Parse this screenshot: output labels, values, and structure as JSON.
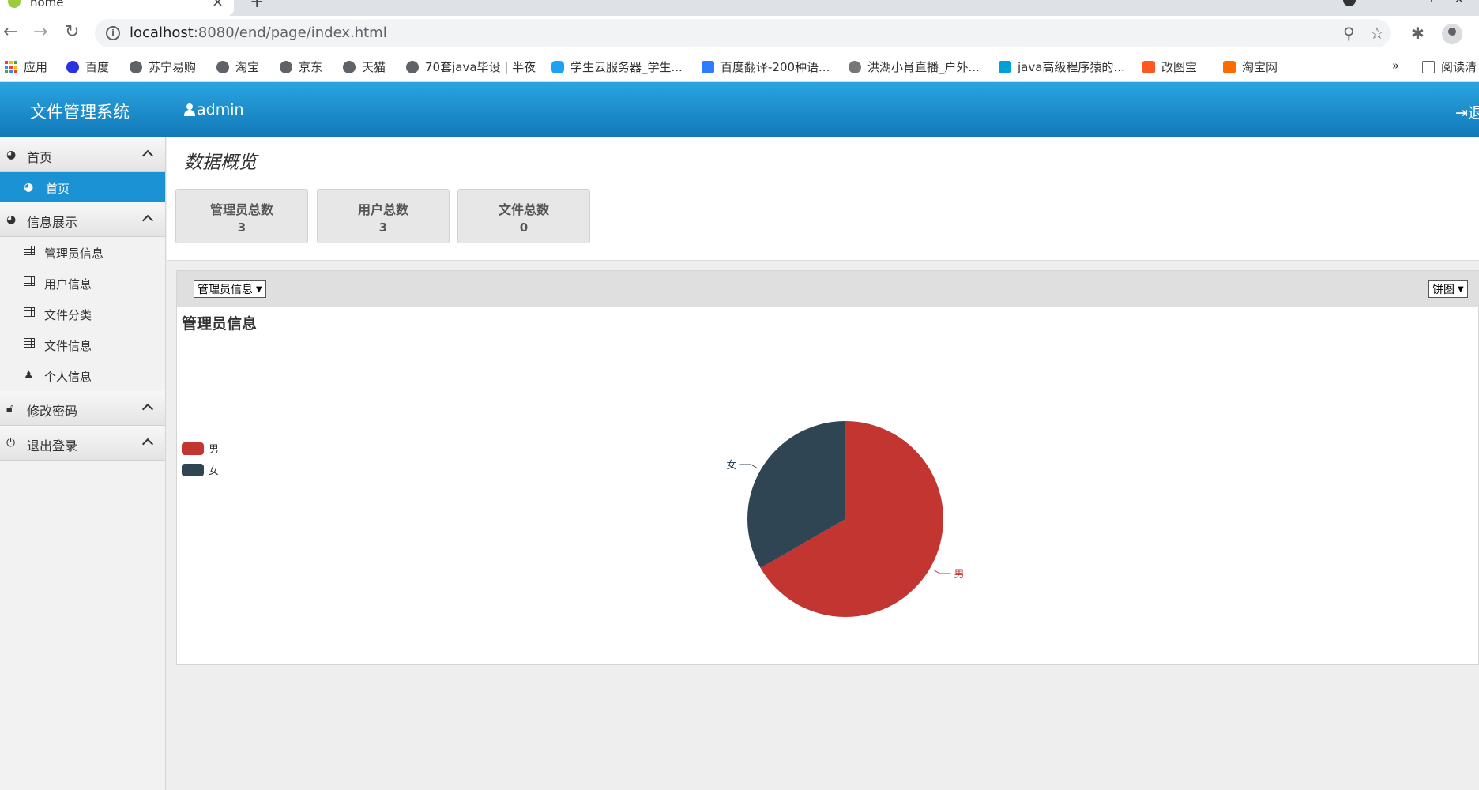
{
  "browser": {
    "tab_title": "home",
    "url_host": "localhost",
    "url_path": ":8080/end/page/index.html",
    "bookmarks": [
      "应用",
      "百度",
      "苏宁易购",
      "淘宝",
      "京东",
      "天猫",
      "70套java毕设 | 半夜",
      "学生云服务器_学生...",
      "百度翻译-200种语...",
      "洪湖小肖直播_户外...",
      "java高级程序猿的...",
      "改图宝",
      "淘宝网",
      "阅读清"
    ],
    "more_bookmarks": "»"
  },
  "header": {
    "title": "文件管理系统",
    "user": "admin",
    "logout": "退"
  },
  "sidebar": {
    "groups": [
      {
        "label": "首页",
        "items": [
          {
            "label": "首页",
            "icon": "dashboard-icon"
          }
        ]
      },
      {
        "label": "信息展示",
        "items": [
          {
            "label": "管理员信息",
            "icon": "table-icon"
          },
          {
            "label": "用户信息",
            "icon": "table-icon"
          },
          {
            "label": "文件分类",
            "icon": "table-icon"
          },
          {
            "label": "文件信息",
            "icon": "table-icon"
          },
          {
            "label": "个人信息",
            "icon": "user-icon"
          }
        ]
      },
      {
        "label": "修改密码",
        "items": []
      },
      {
        "label": "退出登录",
        "items": []
      }
    ]
  },
  "overview": {
    "title": "数据概览",
    "stats": [
      {
        "label": "管理员总数",
        "value": "3"
      },
      {
        "label": "用户总数",
        "value": "3"
      },
      {
        "label": "文件总数",
        "value": "0"
      }
    ]
  },
  "panel": {
    "source_select": "管理员信息",
    "type_select": "饼图"
  },
  "chart_data": {
    "type": "pie",
    "title": "管理员信息",
    "series": [
      {
        "name": "男",
        "value": 2,
        "color": "#c23531"
      },
      {
        "name": "女",
        "value": 1,
        "color": "#2f4554"
      }
    ],
    "legend_position": "left"
  }
}
